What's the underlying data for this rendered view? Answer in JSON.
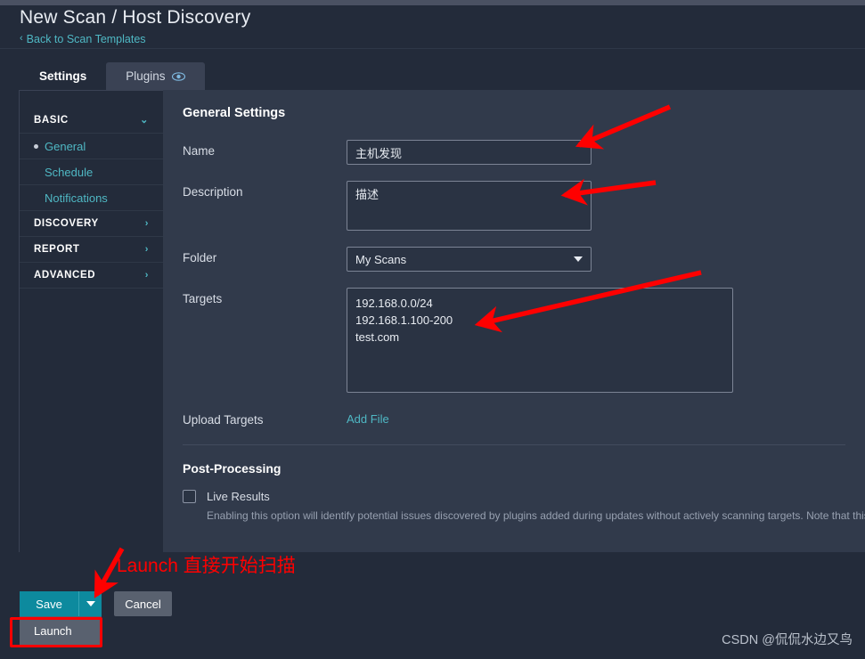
{
  "header": {
    "title": "New Scan / Host Discovery",
    "back_link": "Back to Scan Templates",
    "back_chevron": "‹"
  },
  "tabs": [
    {
      "label": "Settings",
      "active": true,
      "icon": ""
    },
    {
      "label": "Plugins",
      "active": false,
      "icon": "eye-icon"
    }
  ],
  "sidebar": {
    "groups": [
      {
        "label": "BASIC",
        "chevron": "⌄",
        "expanded": true,
        "items": [
          {
            "label": "General",
            "selected": true
          },
          {
            "label": "Schedule",
            "selected": false
          },
          {
            "label": "Notifications",
            "selected": false
          }
        ]
      },
      {
        "label": "DISCOVERY",
        "chevron": "›",
        "expanded": false,
        "items": []
      },
      {
        "label": "REPORT",
        "chevron": "›",
        "expanded": false,
        "items": []
      },
      {
        "label": "ADVANCED",
        "chevron": "›",
        "expanded": false,
        "items": []
      }
    ]
  },
  "main": {
    "section_title": "General Settings",
    "fields": {
      "name_label": "Name",
      "name_value": "主机发现",
      "description_label": "Description",
      "description_value": "描述",
      "folder_label": "Folder",
      "folder_value": "My Scans",
      "targets_label": "Targets",
      "targets_value": "192.168.0.0/24\n192.168.1.100-200\ntest.com",
      "upload_targets_label": "Upload Targets",
      "add_file_link": "Add File"
    },
    "post_processing": {
      "title": "Post-Processing",
      "live_results_label": "Live Results",
      "live_results_checked": false,
      "help_text": "Enabling this option will identify potential issues discovered by plugins added during updates without actively scanning targets. Note that this req"
    }
  },
  "footer": {
    "save_label": "Save",
    "cancel_label": "Cancel",
    "launch_label": "Launch"
  },
  "annotations": {
    "launch_note": "Launch 直接开始扫描",
    "color": "#ff0000"
  },
  "watermark": "CSDN @侃侃水边又鸟",
  "colors": {
    "page_bg": "#232b3a",
    "content_bg": "#313a4b",
    "accent_teal": "#4fb8c4",
    "save_teal": "#0d8a9e",
    "annotation_red": "#ff0000"
  }
}
